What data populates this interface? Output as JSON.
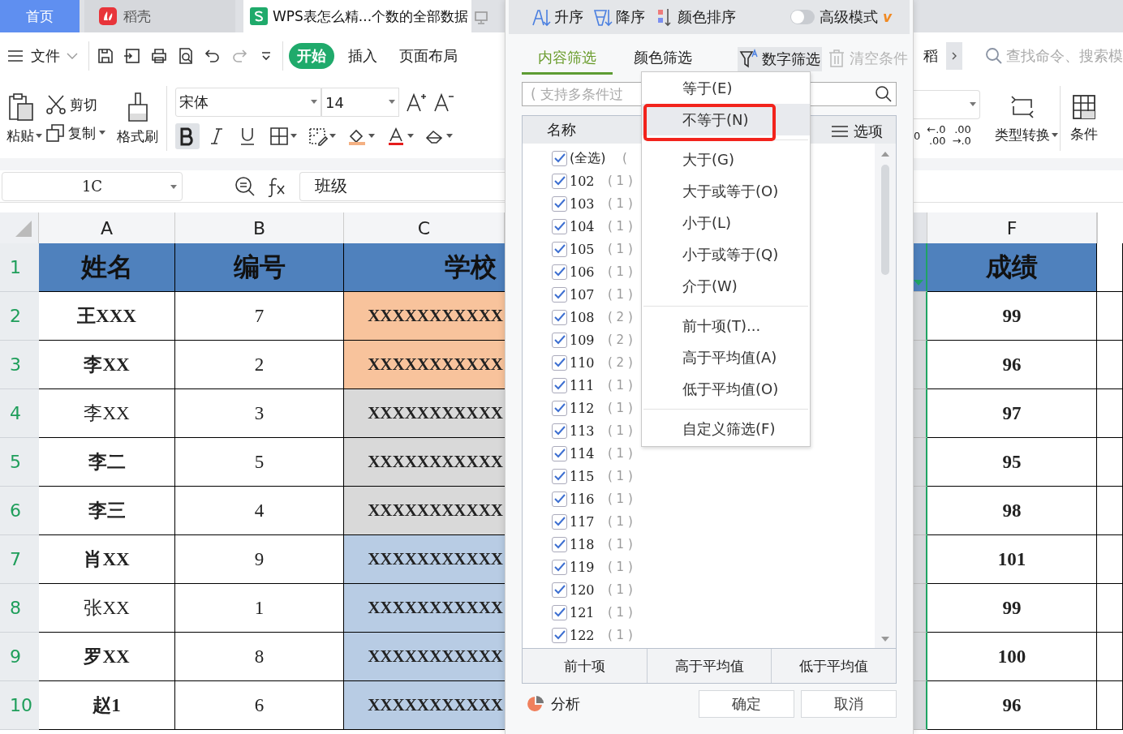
{
  "tabs": [
    {
      "label": "首页",
      "kind": "home",
      "selected": false
    },
    {
      "label": "稻壳",
      "kind": "docer",
      "selected": false
    },
    {
      "label": "WPS表怎么精...个数的全部数据",
      "kind": "sheet",
      "selected": true
    }
  ],
  "menu_bar": {
    "file": "文件",
    "ribbon_tabs": [
      {
        "label": "开始",
        "selected": true
      },
      {
        "label": "插入",
        "selected": false
      },
      {
        "label": "页面布局",
        "selected": false
      }
    ],
    "docer_short": "稻",
    "search_placeholder": "查找命令、搜索模"
  },
  "ribbon": {
    "paste": "粘贴",
    "cut": "剪切",
    "copy": "复制",
    "format_painter": "格式刷",
    "font": "宋体",
    "size": "14",
    "bold_on": true,
    "number_fragment": "0",
    "decimal_buttons": [
      {
        "top": "←.0",
        "bottom": ".00"
      },
      {
        "top": ".00",
        "bottom": "→.0"
      }
    ],
    "type_convert": "类型转换",
    "conditional": "条件"
  },
  "formula_bar": {
    "cell": "1C",
    "content": "班级"
  },
  "sheet": {
    "columns_left": [
      "A",
      "B",
      "C"
    ],
    "columns_right": [
      "F"
    ],
    "rows": [
      {
        "number": "1",
        "kind": "header",
        "color": "#4f81bd",
        "a": "姓名",
        "a_bold": true,
        "b": "编号",
        "c": "学校",
        "f": "成绩"
      },
      {
        "number": "2",
        "kind": "data",
        "color": "#f8c39c",
        "a": "王XXX",
        "a_bold": true,
        "b": "7",
        "c": "XXXXXXXXXXX",
        "f": "99"
      },
      {
        "number": "3",
        "kind": "data",
        "color": "#f8c39c",
        "a": "李XX",
        "a_bold": true,
        "b": "2",
        "c": "XXXXXXXXXXX",
        "f": "96"
      },
      {
        "number": "4",
        "kind": "data",
        "color": "#d9d9d9",
        "a": "李XX",
        "a_bold": false,
        "b": "3",
        "c": "XXXXXXXXXXX",
        "f": "97"
      },
      {
        "number": "5",
        "kind": "data",
        "color": "#d9d9d9",
        "a": "李二",
        "a_bold": true,
        "b": "5",
        "c": "XXXXXXXXXXX",
        "f": "95"
      },
      {
        "number": "6",
        "kind": "data",
        "color": "#d9d9d9",
        "a": "李三",
        "a_bold": true,
        "b": "4",
        "c": "XXXXXXXXXXX",
        "f": "98"
      },
      {
        "number": "7",
        "kind": "data",
        "color": "#b8cce4",
        "a": "肖XX",
        "a_bold": true,
        "b": "9",
        "c": "XXXXXXXXXXX",
        "f": "101"
      },
      {
        "number": "8",
        "kind": "data",
        "color": "#b8cce4",
        "a": "张XX",
        "a_bold": false,
        "b": "1",
        "c": "XXXXXXXXXXX",
        "f": "99"
      },
      {
        "number": "9",
        "kind": "data",
        "color": "#b8cce4",
        "a": "罗XX",
        "a_bold": true,
        "b": "8",
        "c": "XXXXXXXXXXX",
        "f": "100"
      },
      {
        "number": "10",
        "kind": "data",
        "color": "#b8cce4",
        "a": "赵1",
        "a_bold": true,
        "b": "6",
        "c": "XXXXXXXXXXX",
        "f": "96"
      }
    ]
  },
  "filter_dialog": {
    "sort_buttons": [
      {
        "label": "升序",
        "kind": "ascending"
      },
      {
        "label": "降序",
        "kind": "descending"
      },
      {
        "label": "颜色排序",
        "kind": "color"
      }
    ],
    "advanced_mode": {
      "label": "高级模式",
      "on": false,
      "badge": "v"
    },
    "filter_tabs": [
      {
        "label": "内容筛选",
        "selected": true
      },
      {
        "label": "颜色筛选",
        "selected": false
      }
    ],
    "number_filter": {
      "label": "数字筛选",
      "pressed": true
    },
    "clear": {
      "label": "清空条件",
      "disabled": true
    },
    "search_placeholder": "( 支持多条件过",
    "list_header": "名称",
    "options": "选项",
    "items": [
      {
        "label": "(全选)",
        "count": "(",
        "checked": true
      },
      {
        "label": "102",
        "count": "( 1 )",
        "checked": true
      },
      {
        "label": "103",
        "count": "( 1 )",
        "checked": true
      },
      {
        "label": "104",
        "count": "( 1 )",
        "checked": true
      },
      {
        "label": "105",
        "count": "( 1 )",
        "checked": true
      },
      {
        "label": "106",
        "count": "( 1 )",
        "checked": true
      },
      {
        "label": "107",
        "count": "( 1 )",
        "checked": true
      },
      {
        "label": "108",
        "count": "( 2 )",
        "checked": true
      },
      {
        "label": "109",
        "count": "( 2 )",
        "checked": true
      },
      {
        "label": "110",
        "count": "( 2 )",
        "checked": true
      },
      {
        "label": "111",
        "count": "( 1 )",
        "checked": true
      },
      {
        "label": "112",
        "count": "( 1 )",
        "checked": true
      },
      {
        "label": "113",
        "count": "( 1 )",
        "checked": true
      },
      {
        "label": "114",
        "count": "( 1 )",
        "checked": true
      },
      {
        "label": "115",
        "count": "( 1 )",
        "checked": true
      },
      {
        "label": "116",
        "count": "( 1 )",
        "checked": true
      },
      {
        "label": "117",
        "count": "( 1 )",
        "checked": true
      },
      {
        "label": "118",
        "count": "( 1 )",
        "checked": true
      },
      {
        "label": "119",
        "count": "( 1 )",
        "checked": true
      },
      {
        "label": "120",
        "count": "( 1 )",
        "checked": true
      },
      {
        "label": "121",
        "count": "( 1 )",
        "checked": true
      },
      {
        "label": "122",
        "count": "( 1 )",
        "checked": true
      }
    ],
    "quick_buttons": [
      "前十项",
      "高于平均值",
      "低于平均值"
    ],
    "analyze": "分析",
    "ok": "确定",
    "cancel": "取消"
  },
  "number_menu": {
    "groups": [
      [
        {
          "label": "等于(E)",
          "selected": false,
          "annotated": false
        },
        {
          "label": "不等于(N)",
          "selected": true,
          "annotated": true
        }
      ],
      [
        {
          "label": "大于(G)",
          "selected": false,
          "annotated": false
        },
        {
          "label": "大于或等于(O)",
          "selected": false,
          "annotated": false
        },
        {
          "label": "小于(L)",
          "selected": false,
          "annotated": false
        },
        {
          "label": "小于或等于(Q)",
          "selected": false,
          "annotated": false
        },
        {
          "label": "介于(W)",
          "selected": false,
          "annotated": false
        }
      ],
      [
        {
          "label": "前十项(T)...",
          "selected": false,
          "annotated": false
        },
        {
          "label": "高于平均值(A)",
          "selected": false,
          "annotated": false
        },
        {
          "label": "低于平均值(O)",
          "selected": false,
          "annotated": false
        }
      ],
      [
        {
          "label": "自定义筛选(F)",
          "selected": false,
          "annotated": false
        }
      ]
    ]
  }
}
